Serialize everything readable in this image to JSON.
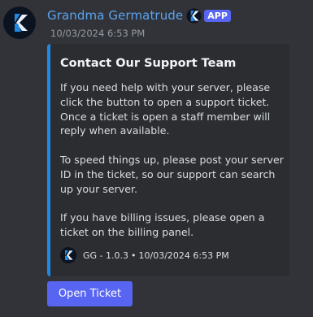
{
  "message": {
    "author": {
      "username": "Grandma Germatrude",
      "badge": "APP",
      "avatar_icon": "gg-logo-icon"
    },
    "timestamp": "10/03/2024 6:53 PM",
    "embed": {
      "accent_color": "#1e8ae6",
      "title": "Contact Our Support Team",
      "paragraphs": [
        "If you need help with your server, please click the button to open a support ticket. Once a ticket is open a staff member will reply when available.",
        "To speed things up, please post your server ID in the ticket, so our support can search up your server.",
        "If you have billing issues, please open a ticket on the billing panel."
      ],
      "footer": {
        "icon": "gg-logo-icon",
        "text": "GG - 1.0.3",
        "separator": "•",
        "timestamp": "10/03/2024 6:53 PM"
      }
    },
    "buttons": [
      {
        "label": "Open Ticket",
        "color": "#5865f2"
      }
    ]
  },
  "colors": {
    "background": "#313338",
    "embed_background": "#2b2d31",
    "username": "#5aa3f0",
    "badge": "#5865f2"
  }
}
